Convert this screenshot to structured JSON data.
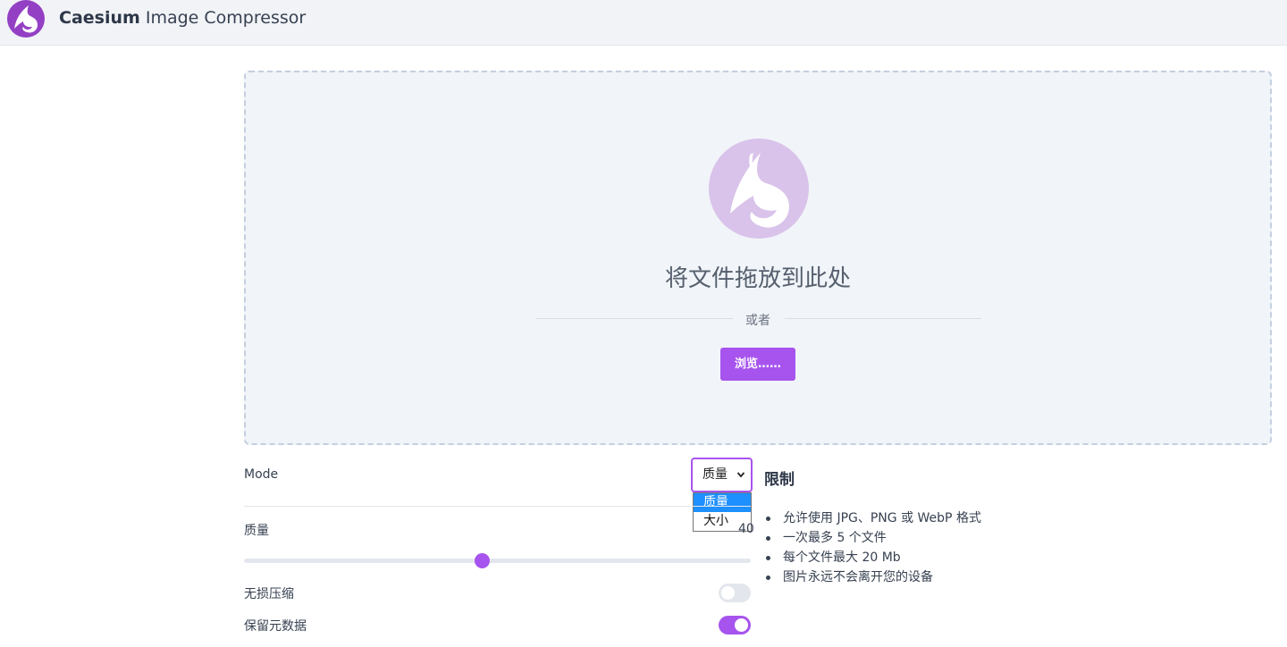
{
  "header": {
    "app_name_bold": "Caesium",
    "app_name_rest": " Image Compressor",
    "logo_icon": "caesium-bird-logo-icon"
  },
  "dropzone": {
    "title": "将文件拖放到此处",
    "or_text": "或者",
    "browse_label": "浏览……"
  },
  "settings": {
    "mode_label": "Mode",
    "mode_selected": "质量",
    "mode_options": [
      "质量",
      "大小"
    ],
    "quality_label": "质量",
    "quality_value": "40",
    "quality_fraction": 0.47,
    "lossless_label": "无损压缩",
    "lossless_enabled": false,
    "keep_metadata_label": "保留元数据",
    "keep_metadata_enabled": true
  },
  "limits": {
    "title": "限制",
    "items": [
      "允许使用 JPG、PNG 或 WebP 格式",
      "一次最多 5 个文件",
      "每个文件最大 20 Mb",
      "图片永远不会离开您的设备"
    ]
  },
  "colors": {
    "accent": "#a754ee",
    "logo": "#9340c4",
    "logo_light": "#d9c3ea",
    "highlight": "#1e90ff"
  }
}
